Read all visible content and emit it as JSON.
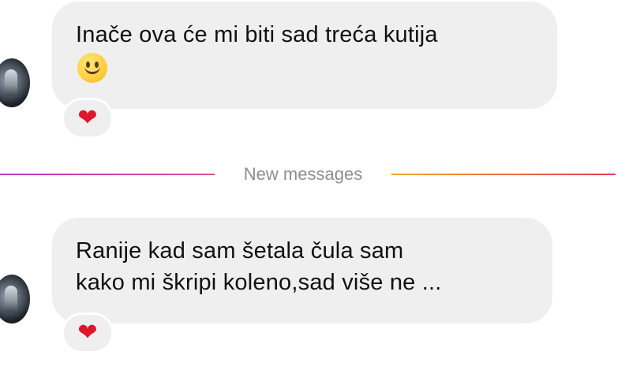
{
  "messages": [
    {
      "lines": [
        "Inače ova će mi biti sad treća kutija"
      ],
      "emoji": "slightly-smiling-face-emoji",
      "reaction": "❤"
    },
    {
      "lines": [
        "Ranije kad sam šetala čula sam",
        "kako mi škripi koleno,sad više ne ..."
      ],
      "reaction": "❤"
    }
  ],
  "divider": {
    "label": "New messages",
    "colors": {
      "left_start": "#c237c4",
      "left_end": "#e04a9a",
      "right_start": "#f5a623",
      "right_end": "#e83a5a"
    }
  },
  "colors": {
    "bubble": "#efefef",
    "text": "#111111",
    "divider_text": "#8e8e8e",
    "heart": "#e0162b"
  }
}
